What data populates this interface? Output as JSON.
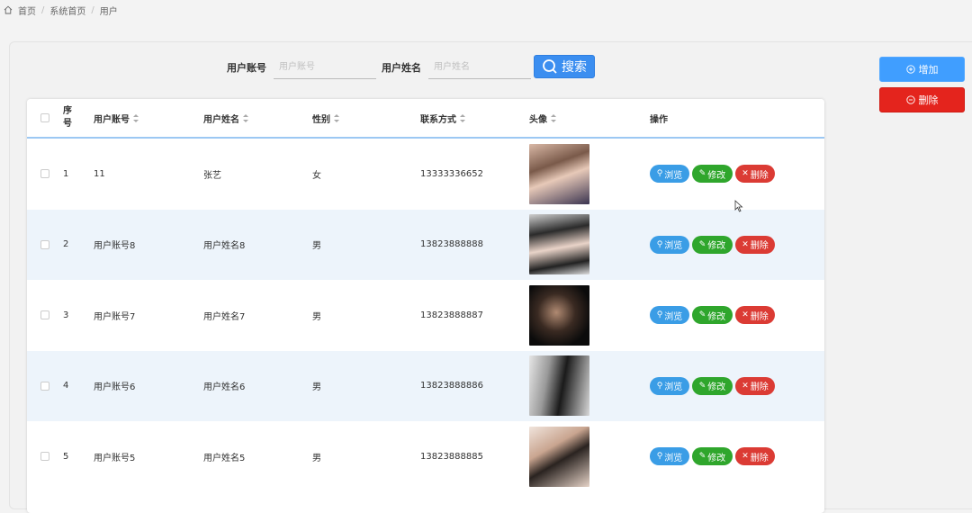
{
  "breadcrumb": [
    "首页",
    "系统首页",
    "用户"
  ],
  "search": {
    "account_label": "用户账号",
    "account_placeholder": "用户账号",
    "name_label": "用户姓名",
    "name_placeholder": "用户姓名",
    "button_label": "搜索"
  },
  "side_buttons": {
    "add_label": "增加",
    "delete_label": "删除"
  },
  "table": {
    "headers": {
      "index": "序号",
      "account": "用户账号",
      "name": "用户姓名",
      "sex": "性别",
      "phone": "联系方式",
      "avatar": "头像",
      "ops": "操作"
    },
    "rows": [
      {
        "index": "1",
        "account": "11",
        "name": "张艺",
        "sex": "女",
        "phone": "13333336652"
      },
      {
        "index": "2",
        "account": "用户账号8",
        "name": "用户姓名8",
        "sex": "男",
        "phone": "13823888888"
      },
      {
        "index": "3",
        "account": "用户账号7",
        "name": "用户姓名7",
        "sex": "男",
        "phone": "13823888887"
      },
      {
        "index": "4",
        "account": "用户账号6",
        "name": "用户姓名6",
        "sex": "男",
        "phone": "13823888886"
      },
      {
        "index": "5",
        "account": "用户账号5",
        "name": "用户姓名5",
        "sex": "男",
        "phone": "13823888885"
      }
    ],
    "op_labels": {
      "view": "浏览",
      "edit": "修改",
      "delete": "删除"
    }
  },
  "colors": {
    "primary": "#409eff",
    "danger": "#e4241d",
    "success": "#2fa62c",
    "stripe": "#edf4fb"
  }
}
